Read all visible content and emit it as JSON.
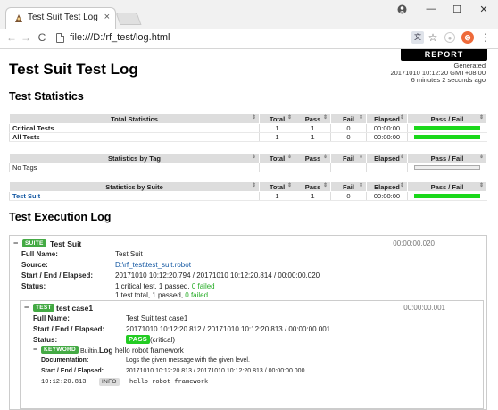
{
  "browser": {
    "tab_title": "Test Suit Test Log",
    "tab_close": "×",
    "url": "file:///D:/rf_test/log.html",
    "window_controls": [
      "—",
      "☐",
      "✕"
    ],
    "nav": {
      "back": "←",
      "forward": "→",
      "reload": "C"
    },
    "toolbar_icons": {
      "translate": "文",
      "star": "☆",
      "ext1": "●",
      "ext2": "⊗",
      "menu": "⋮"
    },
    "account_icon": "●"
  },
  "header": {
    "report_button": "REPORT",
    "generated_label": "Generated",
    "generated_time": "20171010 10:12:20 GMT+08:00",
    "generated_ago": "6 minutes 2 seconds ago",
    "title": "Test Suit Test Log"
  },
  "statistics": {
    "heading": "Test Statistics",
    "columns": [
      "Total",
      "Pass",
      "Fail",
      "Elapsed",
      "Pass / Fail"
    ],
    "total_header": "Total Statistics",
    "total_rows": [
      {
        "name": "Critical Tests",
        "total": "1",
        "pass": "1",
        "fail": "0",
        "elapsed": "00:00:00",
        "pass_ratio": 1
      },
      {
        "name": "All Tests",
        "total": "1",
        "pass": "1",
        "fail": "0",
        "elapsed": "00:00:00",
        "pass_ratio": 1
      }
    ],
    "tag_header": "Statistics by Tag",
    "tag_rows": [
      {
        "name": "No Tags"
      }
    ],
    "suite_header": "Statistics by Suite",
    "suite_rows": [
      {
        "name": "Test Suit",
        "total": "1",
        "pass": "1",
        "fail": "0",
        "elapsed": "00:00:00",
        "pass_ratio": 1
      }
    ]
  },
  "execution": {
    "heading": "Test Execution Log",
    "suite": {
      "toggle": "−",
      "badge": "SUITE",
      "name": "Test Suit",
      "elapsed": "00:00:00.020",
      "full_name_label": "Full Name:",
      "full_name": "Test Suit",
      "source_label": "Source:",
      "source": "D:\\rf_test\\test_suit.robot",
      "timing_label": "Start / End / Elapsed:",
      "timing": "20171010 10:12:20.794 / 20171010 10:12:20.814 / 00:00:00.020",
      "status_label": "Status:",
      "status_line1": "1 critical test, 1 passed, ",
      "status_line1_failed": "0 failed",
      "status_line2": "1 test total, 1 passed, ",
      "status_line2_failed": "0 failed"
    },
    "test": {
      "toggle": "−",
      "badge": "TEST",
      "name": "test case1",
      "elapsed": "00:00:00.001",
      "full_name_label": "Full Name:",
      "full_name": "Test Suit.test case1",
      "timing_label": "Start / End / Elapsed:",
      "timing": "20171010 10:12:20.812 / 20171010 10:12:20.813 / 00:00:00.001",
      "status_label": "Status:",
      "status_badge": "PASS",
      "status_note": "(critical)"
    },
    "keyword": {
      "toggle": "−",
      "badge": "KEYWORD",
      "library": "Builtin.",
      "name": "Log",
      "args": "hello robot framework",
      "doc_label": "Documentation:",
      "doc": "Logs the given message with the given level.",
      "timing_label": "Start / End / Elapsed:",
      "timing": "20171010 10:12:20.813 / 20171010 10:12:20.813 / 00:00:00.000",
      "msg_time": "10:12:20.813",
      "msg_level": "INFO",
      "msg_text": "hello robot framework"
    }
  },
  "colors": {
    "pass": "#1bd81b",
    "badge": "#44aa44",
    "link": "#1559a3",
    "header_gray": "#dddddd"
  }
}
